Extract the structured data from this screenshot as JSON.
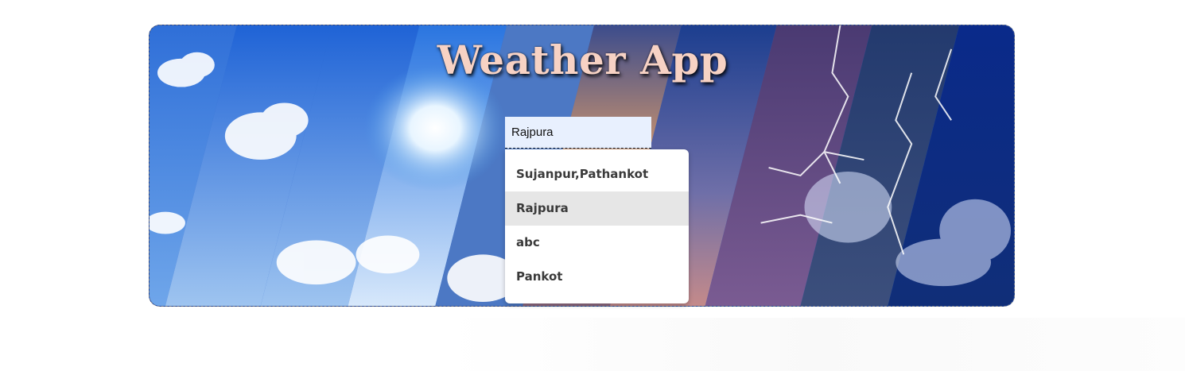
{
  "app": {
    "title": "Weather App"
  },
  "search": {
    "value": "Rajpura"
  },
  "suggestions": [
    {
      "label": "Sujanpur,Pathankot",
      "active": false
    },
    {
      "label": "Rajpura",
      "active": true
    },
    {
      "label": "abc",
      "active": false
    },
    {
      "label": "Pankot",
      "active": false
    }
  ],
  "colors": {
    "title": "#f7d2c4",
    "input_bg": "#e8f0fe",
    "dropdown_active": "#e6e6e6",
    "card_border": "#6b7280"
  }
}
